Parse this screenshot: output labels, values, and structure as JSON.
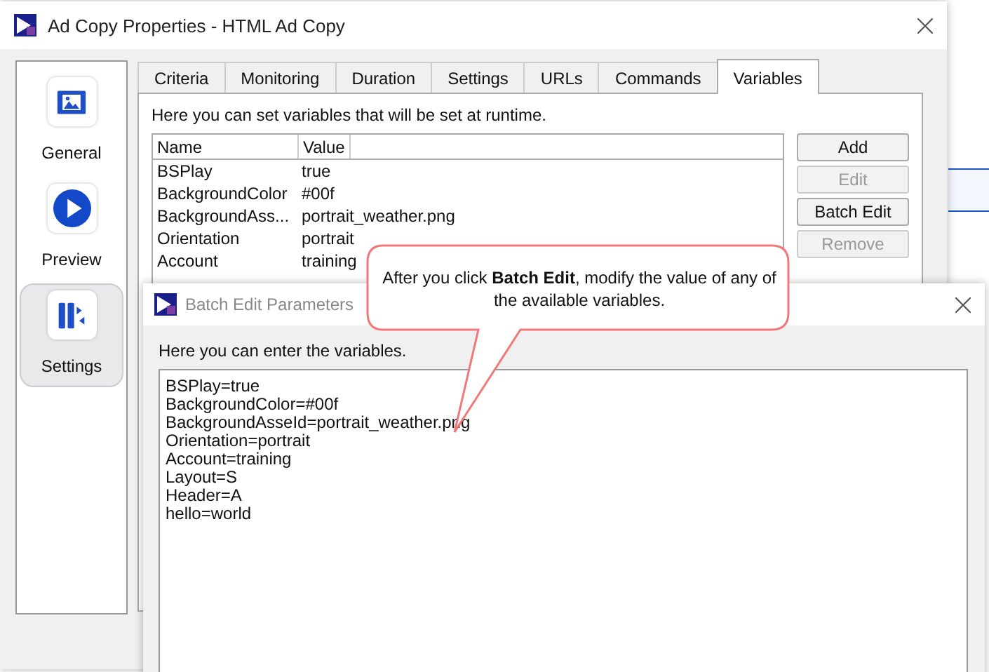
{
  "main_window": {
    "title": "Ad Copy Properties - HTML Ad Copy"
  },
  "sidebar": {
    "items": [
      {
        "label": "General",
        "kind": "media",
        "selected": false
      },
      {
        "label": "Preview",
        "kind": "play",
        "selected": false
      },
      {
        "label": "Settings",
        "kind": "settings",
        "selected": true
      }
    ]
  },
  "tabs": [
    {
      "label": "Criteria",
      "selected": false
    },
    {
      "label": "Monitoring",
      "selected": false
    },
    {
      "label": "Duration",
      "selected": false
    },
    {
      "label": "Settings",
      "selected": false
    },
    {
      "label": "URLs",
      "selected": false
    },
    {
      "label": "Commands",
      "selected": false
    },
    {
      "label": "Variables",
      "selected": true
    }
  ],
  "variables_panel": {
    "description": "Here you can set variables that will be set at runtime.",
    "table": {
      "columns": [
        "Name",
        "Value"
      ],
      "rows": [
        [
          "BSPlay",
          "true"
        ],
        [
          "BackgroundColor",
          "#00f"
        ],
        [
          "BackgroundAss...",
          "portrait_weather.png"
        ],
        [
          "Orientation",
          "portrait"
        ],
        [
          "Account",
          "training"
        ]
      ]
    },
    "buttons": [
      {
        "label": "Add",
        "disabled": false
      },
      {
        "label": "Edit",
        "disabled": true
      },
      {
        "label": "Batch Edit",
        "disabled": false
      },
      {
        "label": "Remove",
        "disabled": true
      }
    ]
  },
  "batch_dialog": {
    "title": "Batch Edit Parameters",
    "description": "Here you can enter the variables.",
    "lines": [
      "BSPlay=true",
      "BackgroundColor=#00f",
      "BackgroundAsseId=portrait_weather.png",
      "Orientation=portrait",
      "Account=training",
      "Layout=S",
      "Header=A",
      "hello=world"
    ]
  },
  "callout": {
    "text": "After you click **Batch Edit**, modify the value of any of the available variables."
  }
}
